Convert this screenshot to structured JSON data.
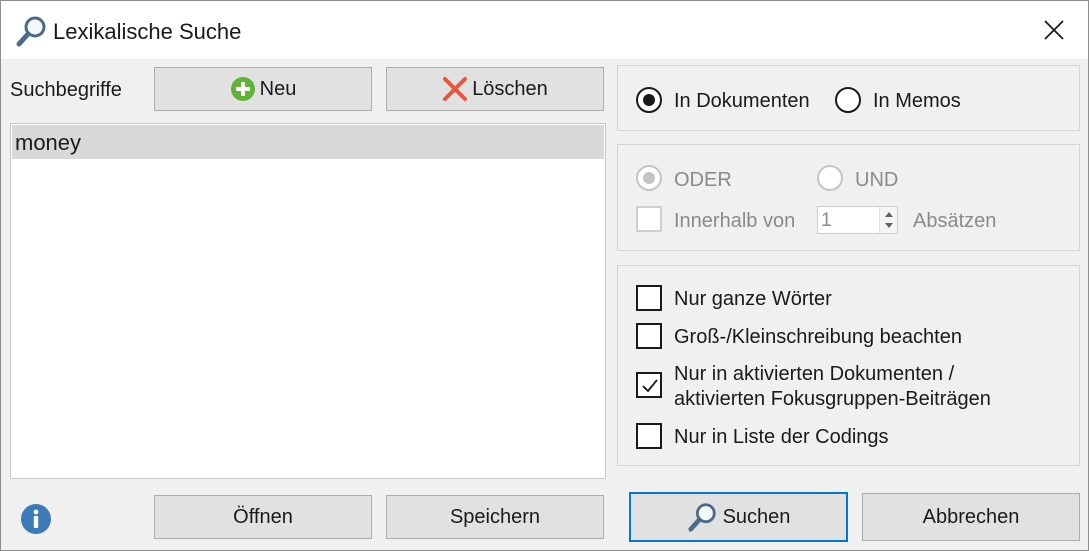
{
  "window": {
    "title": "Lexikalische Suche",
    "icons": {
      "title": "magnifier-icon",
      "close": "close-icon"
    }
  },
  "search_terms": {
    "label": "Suchbegriffe",
    "new_label": "Neu",
    "delete_label": "Löschen",
    "items": [
      "money"
    ],
    "open_label": "Öffnen",
    "save_label": "Speichern"
  },
  "scope": {
    "in_documents": {
      "label": "In Dokumenten",
      "selected": true
    },
    "in_memos": {
      "label": "In Memos",
      "selected": false
    }
  },
  "logic": {
    "or_label": "ODER",
    "and_label": "UND",
    "within_label": "Innerhalb von",
    "within_value": "1",
    "paragraphs_label": "Absätzen"
  },
  "options": [
    {
      "label": "Nur ganze Wörter",
      "checked": false
    },
    {
      "label": "Groß-/Kleinschreibung beachten",
      "checked": false
    },
    {
      "label_line1": "Nur in aktivierten Dokumenten /",
      "label_line2": "aktivierten Fokusgruppen-Beiträgen",
      "checked": true
    },
    {
      "label": "Nur in Liste der Codings",
      "checked": false
    }
  ],
  "footer": {
    "search_label": "Suchen",
    "cancel_label": "Abbrechen"
  },
  "colors": {
    "accent": "#0078d7",
    "add_icon": "#5fb336",
    "delete_icon": "#e8553e",
    "info_icon": "#3d7ab8"
  }
}
